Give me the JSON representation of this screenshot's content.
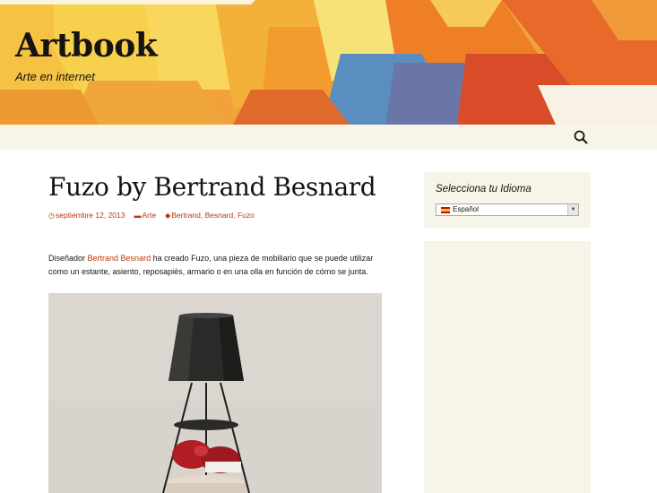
{
  "site": {
    "title": "Artbook",
    "description": "Arte en internet"
  },
  "nav": {
    "search_icon": "search-icon"
  },
  "post": {
    "title": "Fuzo by Bertrand Besnard",
    "meta": {
      "date": "septiembre 12, 2013",
      "category": "Arte",
      "tags": [
        "Bertrand",
        "Besnard",
        "Fuzo"
      ],
      "date_icon": "clock-icon",
      "category_icon": "folder-icon",
      "tag_icon": "tag-icon"
    },
    "body": {
      "prefix": "Diseñador ",
      "link_text": "Bertrand Besnard",
      "suffix": " ha creado Fuzo, una pieza de mobiliario que se puede utilizar como un estante, asiento, reposapiés, armario o en una olla en función de cómo se junta."
    }
  },
  "sidebar": {
    "language_widget": {
      "title": "Selecciona tu Idioma",
      "selected": "Español",
      "flag": "spain-flag"
    }
  },
  "colors": {
    "accent": "#bc360a",
    "sidebar_bg": "#f7f5e7",
    "text": "#141412"
  }
}
